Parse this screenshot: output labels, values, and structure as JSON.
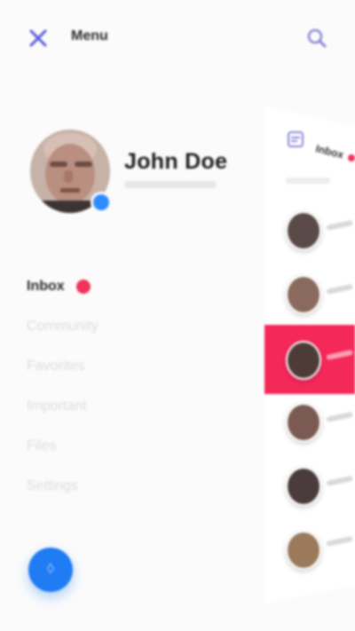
{
  "topbar": {
    "title": "Menu",
    "close_icon": "close-x-icon",
    "search_icon": "search-icon",
    "accent": "#5b5bd6"
  },
  "profile": {
    "name": "John Doe",
    "badge_color": "#2f8cff"
  },
  "nav": {
    "items": [
      {
        "label": "Inbox",
        "active": true,
        "has_unread_dot": true
      },
      {
        "label": "Community",
        "active": false
      },
      {
        "label": "Favorites",
        "active": false
      },
      {
        "label": "Important",
        "active": false
      },
      {
        "label": "Files",
        "active": false
      },
      {
        "label": "Settings",
        "active": false
      }
    ],
    "unread_dot_color": "#f0335c"
  },
  "fab": {
    "icon": "chat-icon",
    "color": "#1f7cf3"
  },
  "inbox_preview": {
    "title": "Inbox",
    "header_icon": "inbox-icon",
    "highlight_color": "#f5285a",
    "row_count": 6,
    "selected_row": 3
  }
}
